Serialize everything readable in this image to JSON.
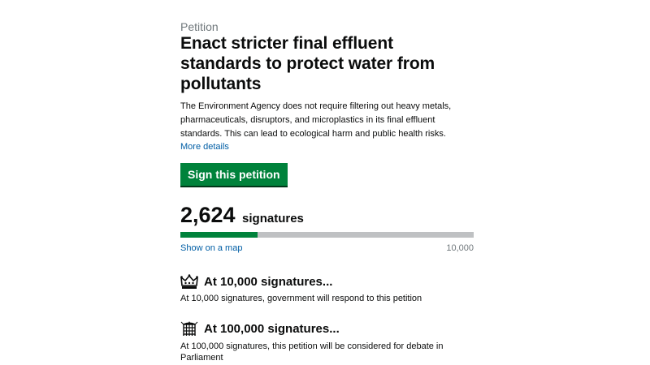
{
  "petition": {
    "eyebrow": "Petition",
    "title": "Enact stricter final effluent standards to protect water from pollutants",
    "summary": "The Environment Agency does not require filtering out heavy metals, pharmaceuticals, disruptors, and microplastics in its final effluent standards. This can lead to ecological harm and public health risks.",
    "more_details": "More details",
    "sign_button": "Sign this petition"
  },
  "signatures": {
    "count": "2,624",
    "label": "signatures",
    "show_map": "Show on a map",
    "target": "10,000",
    "progress_fraction": 0.2624
  },
  "milestones": [
    {
      "icon": "crown-icon",
      "heading": "At 10,000 signatures...",
      "body": "At 10,000 signatures, government will respond to this petition"
    },
    {
      "icon": "parliament-portcullis-icon",
      "heading": "At 100,000 signatures...",
      "body": "At 100,000 signatures, this petition will be considered for debate in Parliament"
    }
  ],
  "colors": {
    "brand_green": "#00823b",
    "link_blue": "#005ea5",
    "muted_grey": "#6f777b",
    "track_grey": "#bfc1c3"
  }
}
